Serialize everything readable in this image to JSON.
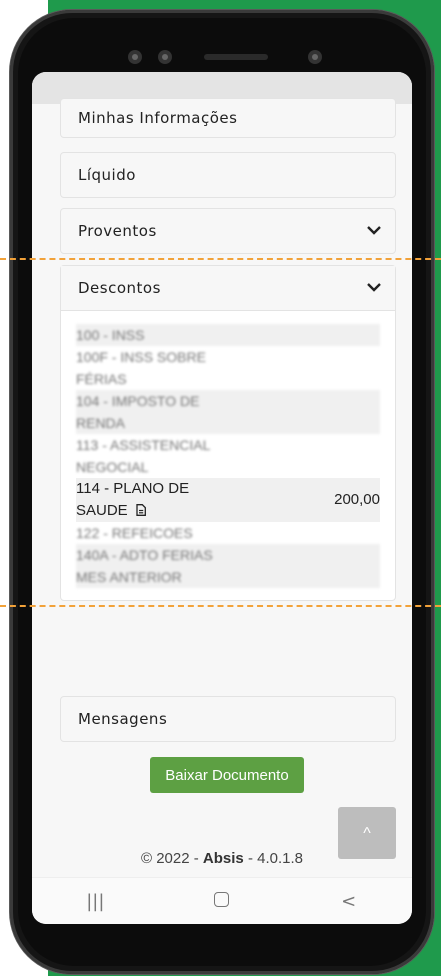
{
  "sections": {
    "minhas_informacoes": "Minhas Informações",
    "liquido": "Líquido",
    "proventos": "Proventos",
    "descontos": "Descontos",
    "mensagens": "Mensagens"
  },
  "descontos_items": [
    {
      "label": "100 - INSS",
      "value": ""
    },
    {
      "label": "100F - INSS SOBRE FÉRIAS",
      "value": ""
    },
    {
      "label": "104 - IMPOSTO DE RENDA",
      "value": ""
    },
    {
      "label": "113 - ASSISTENCIAL NEGOCIAL",
      "value": ""
    },
    {
      "label": "114 - PLANO DE SAUDE",
      "value": "200,00"
    },
    {
      "label": "122 - REFEICOES",
      "value": ""
    },
    {
      "label": "140A - ADTO FERIAS MES ANTERIOR",
      "value": ""
    }
  ],
  "actions": {
    "download": "Baixar Documento",
    "back_to_top": "^"
  },
  "footer": {
    "copyright": "© 2022 - ",
    "brand": "Absis",
    "version": " - 4.0.1.8"
  },
  "nav": {
    "recents": "|||",
    "back": "<"
  },
  "colors": {
    "background_accent": "#1f9a4c",
    "button": "#5da043",
    "annotation_line": "#f2a23a"
  }
}
